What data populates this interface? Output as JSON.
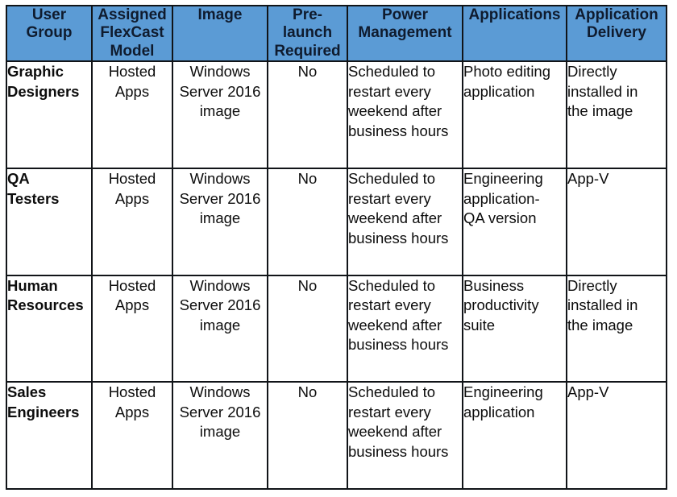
{
  "table": {
    "columns": [
      {
        "key": "user_group",
        "label": "User\nGroup",
        "align": "left-bold"
      },
      {
        "key": "flexcast_model",
        "label": "Assigned\nFlexCast\nModel",
        "align": "center"
      },
      {
        "key": "image",
        "label": "Image",
        "align": "center"
      },
      {
        "key": "prelaunch",
        "label": "Pre-\nlaunch\nRequired",
        "align": "center"
      },
      {
        "key": "power_management",
        "label": "Power\nManagement",
        "align": "left"
      },
      {
        "key": "applications",
        "label": "Applications",
        "align": "left"
      },
      {
        "key": "application_delivery",
        "label": "Application\nDelivery",
        "align": "left"
      }
    ],
    "header_background": "#5B9BD5",
    "header_text_color": "#0F1B2E",
    "border_color": "#111418",
    "body_background": "#FFFFFF",
    "rows": [
      {
        "user_group": "Graphic\nDesigners",
        "flexcast_model": "Hosted\nApps",
        "image": "Windows\nServer 2016\nimage",
        "prelaunch": "No",
        "power_management": "Scheduled to\nrestart every\nweekend after\nbusiness hours",
        "applications": "Photo editing\napplication",
        "application_delivery": "Directly\ninstalled in\nthe image"
      },
      {
        "user_group": "QA\nTesters",
        "flexcast_model": "Hosted\nApps",
        "image": "Windows\nServer 2016\nimage",
        "prelaunch": "No",
        "power_management": "Scheduled to\nrestart every\nweekend after\nbusiness hours",
        "applications": "Engineering\napplication-\nQA version",
        "application_delivery": "App-V"
      },
      {
        "user_group": "Human\nResources",
        "flexcast_model": "Hosted\nApps",
        "image": "Windows\nServer 2016\nimage",
        "prelaunch": "No",
        "power_management": "Scheduled to\nrestart every\nweekend after\nbusiness hours",
        "applications": "Business\nproductivity\nsuite",
        "application_delivery": "Directly\ninstalled in\nthe image"
      },
      {
        "user_group": "Sales\nEngineers",
        "flexcast_model": "Hosted\nApps",
        "image": "Windows\nServer 2016\nimage",
        "prelaunch": "No",
        "power_management": "Scheduled to\nrestart every\nweekend after\nbusiness hours",
        "applications": "Engineering\napplication",
        "application_delivery": "App-V"
      }
    ]
  }
}
